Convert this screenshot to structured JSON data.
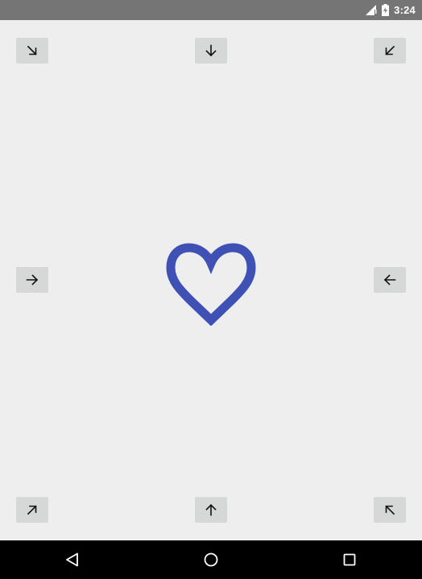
{
  "status_bar": {
    "time": "3:24",
    "icons": [
      "signal-icon",
      "battery-charging-icon"
    ]
  },
  "arrows": [
    {
      "name": "arrow-top-left-button",
      "direction": "down-right"
    },
    {
      "name": "arrow-top-center-button",
      "direction": "down"
    },
    {
      "name": "arrow-top-right-button",
      "direction": "down-left"
    },
    {
      "name": "arrow-middle-left-button",
      "direction": "right"
    },
    {
      "name": "arrow-middle-right-button",
      "direction": "left"
    },
    {
      "name": "arrow-bottom-left-button",
      "direction": "up-right"
    },
    {
      "name": "arrow-bottom-center-button",
      "direction": "up"
    },
    {
      "name": "arrow-bottom-right-button",
      "direction": "up-left"
    }
  ],
  "heart": {
    "icon": "heart-outline-icon",
    "color": "#3f51b5"
  },
  "nav_bar": {
    "buttons": [
      "back-icon",
      "home-icon",
      "recents-icon"
    ]
  }
}
